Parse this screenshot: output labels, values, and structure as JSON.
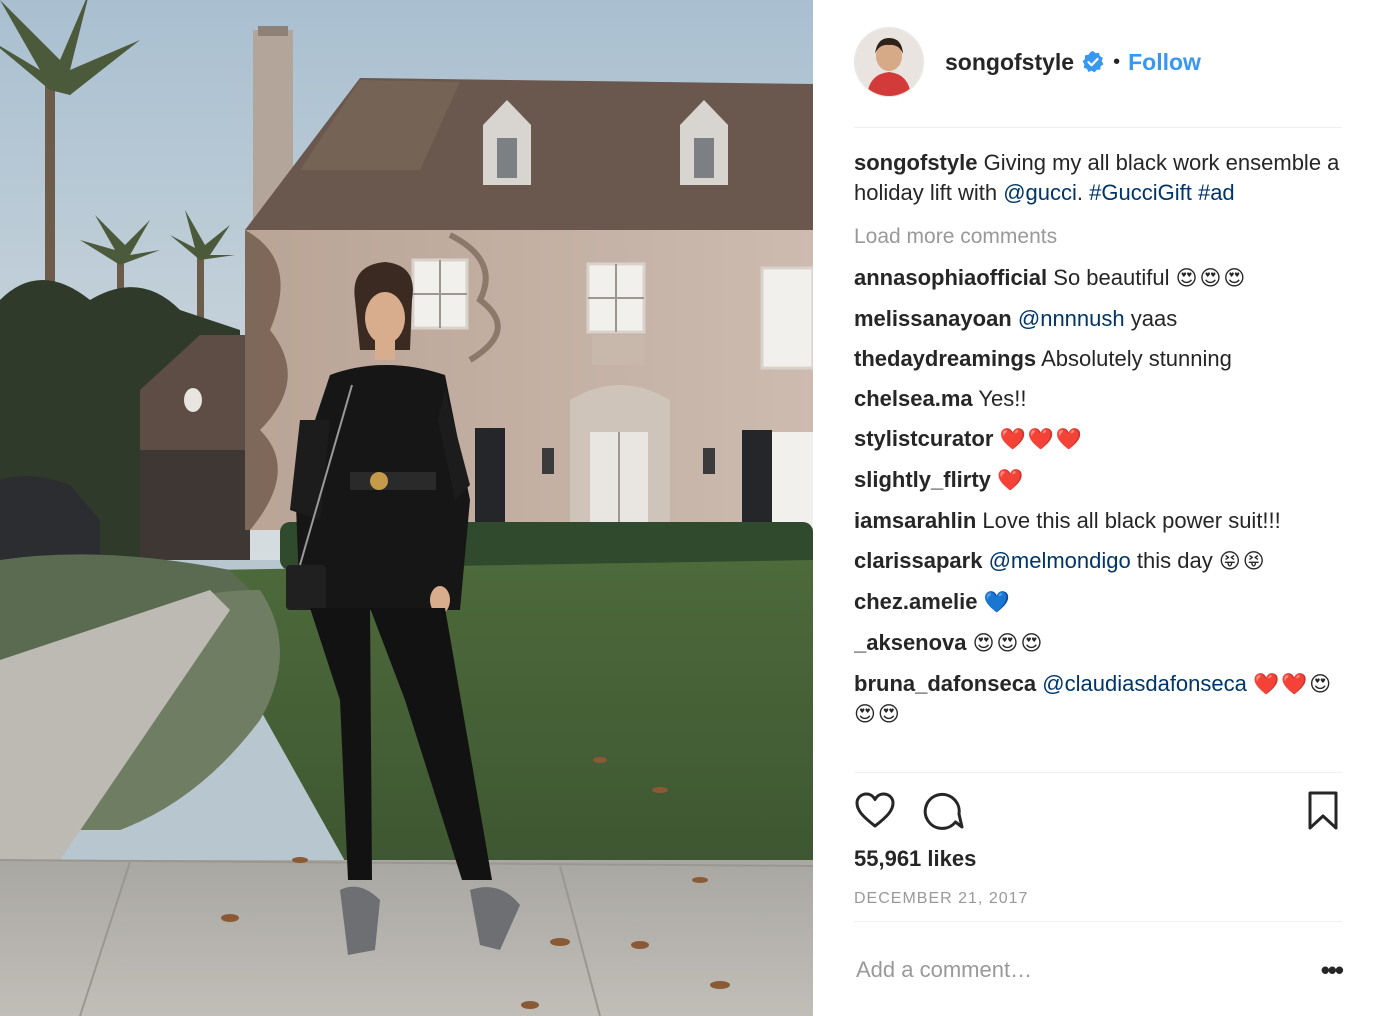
{
  "post": {
    "image_alt": "Woman in an all black suit standing in front of a large ivy covered house",
    "author": {
      "username": "songofstyle",
      "verified": true,
      "follow_label": "Follow",
      "separator": "•"
    },
    "caption": {
      "username": "songofstyle",
      "text_before": "Giving my all black work ensemble a holiday lift with",
      "mention": "@gucci",
      "text_after": ".",
      "hashtags": "#GucciGift #ad"
    },
    "load_more_label": "Load more comments",
    "comments": [
      {
        "username": "annasophiaofficial",
        "mention": "",
        "text": "So beautiful",
        "emoji": "😍😍😍"
      },
      {
        "username": "melissanayoan",
        "mention": "@nnnnush",
        "text": "yaas",
        "emoji": ""
      },
      {
        "username": "thedaydreamings",
        "mention": "",
        "text": "Absolutely stunning",
        "emoji": ""
      },
      {
        "username": "chelsea.ma",
        "mention": "",
        "text": "Yes!!",
        "emoji": ""
      },
      {
        "username": "stylistcurator",
        "mention": "",
        "text": "",
        "emoji": "❤️❤️❤️"
      },
      {
        "username": "slightly_flirty",
        "mention": "",
        "text": "",
        "emoji": "❤️"
      },
      {
        "username": "iamsarahlin",
        "mention": "",
        "text": "Love this all black power suit!!!",
        "emoji": ""
      },
      {
        "username": "clarissapark",
        "mention": "@melmondigo",
        "text": "this day",
        "emoji": "😝😝"
      },
      {
        "username": "chez.amelie",
        "mention": "",
        "text": "",
        "emoji": "💙"
      },
      {
        "username": "_aksenova",
        "mention": "",
        "text": "",
        "emoji": "😍😍😍"
      },
      {
        "username": "bruna_dafonseca",
        "mention": "@claudiasdafonseca",
        "text": "",
        "emoji": "❤️❤️😍😍😍"
      }
    ],
    "icons": {
      "like": "heart-icon",
      "comment": "comment-bubble-icon",
      "save": "bookmark-icon",
      "more": "more-options-icon"
    },
    "likes_label": "55,961 likes",
    "date_label": "DECEMBER 21, 2017",
    "add_comment_placeholder": "Add a comment…",
    "more_label": "•••",
    "colors": {
      "follow": "#3897f0",
      "link": "#003569",
      "muted": "#999999",
      "text": "#262626",
      "verified": "#3897f0"
    }
  }
}
